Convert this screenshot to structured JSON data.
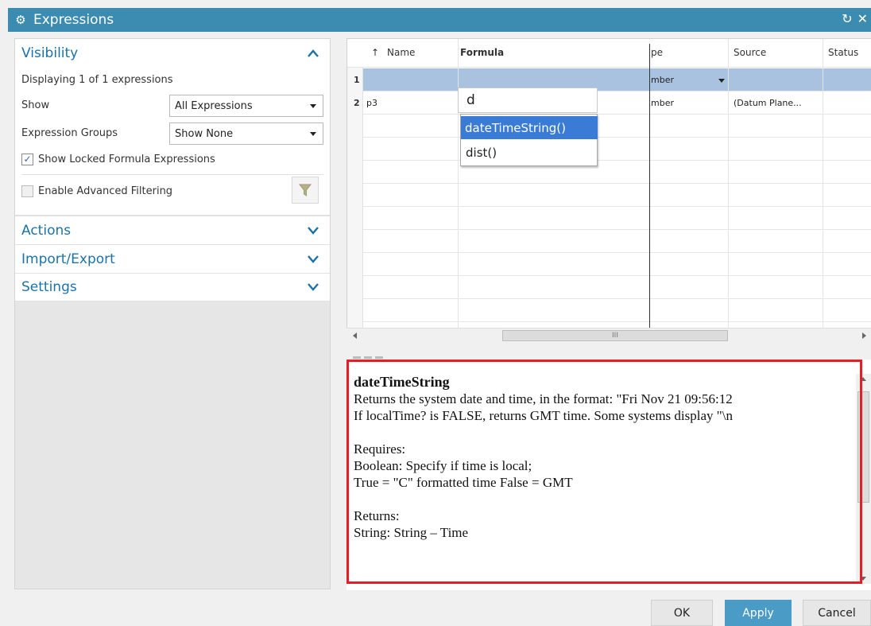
{
  "window": {
    "title": "Expressions"
  },
  "visibility": {
    "title": "Visibility",
    "displaying": "Displaying 1 of 1 expressions",
    "show_label": "Show",
    "show_value": "All Expressions",
    "groups_label": "Expression Groups",
    "groups_value": "Show None",
    "locked_label": "Show Locked Formula Expressions",
    "locked_checked": true,
    "advanced_label": "Enable Advanced Filtering",
    "advanced_checked": false
  },
  "sections": {
    "actions": "Actions",
    "import_export": "Import/Export",
    "settings": "Settings"
  },
  "table": {
    "sort_glyph": "↑",
    "columns": {
      "name": "Name",
      "formula": "Formula",
      "type": "pe",
      "source": "Source",
      "status": "Status"
    },
    "rows": [
      {
        "num": "1",
        "name": "",
        "type": "mber",
        "source": ""
      },
      {
        "num": "2",
        "name": "p3",
        "type": "mber",
        "source": "(Datum Plane..."
      }
    ]
  },
  "autocomplete": {
    "input": "d",
    "items": [
      "dateTimeString()",
      "dist()"
    ]
  },
  "scrollbar": {
    "thumb": "III"
  },
  "description": {
    "title": "dateTimeString",
    "line1": "Returns the system date and time, in the format: \"Fri Nov 21 09:56:12",
    "line2": "If localTime? is FALSE, returns GMT time. Some systems display \"\\n",
    "requires": "Requires:",
    "req1": "Boolean: Specify if time is local;",
    "req2": "True = \"C\"  formatted time False = GMT",
    "returns": "Returns:",
    "ret1": "String: String – Time"
  },
  "buttons": {
    "ok": "OK",
    "apply": "Apply",
    "cancel": "Cancel"
  },
  "colors": {
    "titlebar": "#3c8bb0",
    "accent": "#1a73a8",
    "selection": "#3a7bd5",
    "highlight_box": "#e41e26",
    "apply": "#4a9bc6"
  }
}
